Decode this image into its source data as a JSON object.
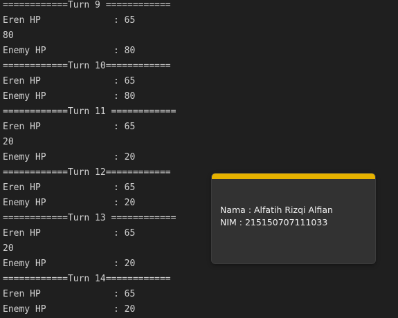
{
  "terminal": {
    "lines": [
      {
        "type": "header",
        "text": "============Turn 9 ============"
      },
      {
        "type": "stat",
        "label": "Eren HP",
        "value": ": 65"
      },
      {
        "type": "plain",
        "text": "80"
      },
      {
        "type": "stat",
        "label": "Enemy HP",
        "value": ": 80"
      },
      {
        "type": "header",
        "text": "============Turn 10============"
      },
      {
        "type": "stat",
        "label": "Eren HP",
        "value": ": 65"
      },
      {
        "type": "stat",
        "label": "Enemy HP",
        "value": ": 80"
      },
      {
        "type": "header",
        "text": "============Turn 11 ============"
      },
      {
        "type": "stat",
        "label": "Eren HP",
        "value": ": 65"
      },
      {
        "type": "plain",
        "text": "20"
      },
      {
        "type": "stat",
        "label": "Enemy HP",
        "value": ": 20"
      },
      {
        "type": "header",
        "text": "============Turn 12============"
      },
      {
        "type": "stat",
        "label": "Eren HP",
        "value": ": 65"
      },
      {
        "type": "stat",
        "label": "Enemy HP",
        "value": ": 20"
      },
      {
        "type": "header",
        "text": "============Turn 13 ============"
      },
      {
        "type": "stat",
        "label": "Eren HP",
        "value": ": 65"
      },
      {
        "type": "plain",
        "text": "20"
      },
      {
        "type": "stat",
        "label": "Enemy HP",
        "value": ": 20"
      },
      {
        "type": "header",
        "text": "============Turn 14============"
      },
      {
        "type": "stat",
        "label": "Eren HP",
        "value": ": 65"
      },
      {
        "type": "stat",
        "label": "Enemy HP",
        "value": ": 20"
      }
    ]
  },
  "sticky_note": {
    "accent_color": "#e6b200",
    "name_line": "Nama : Alfatih Rizqi Alfian",
    "nim_line": "NIM : 215150707111033"
  }
}
